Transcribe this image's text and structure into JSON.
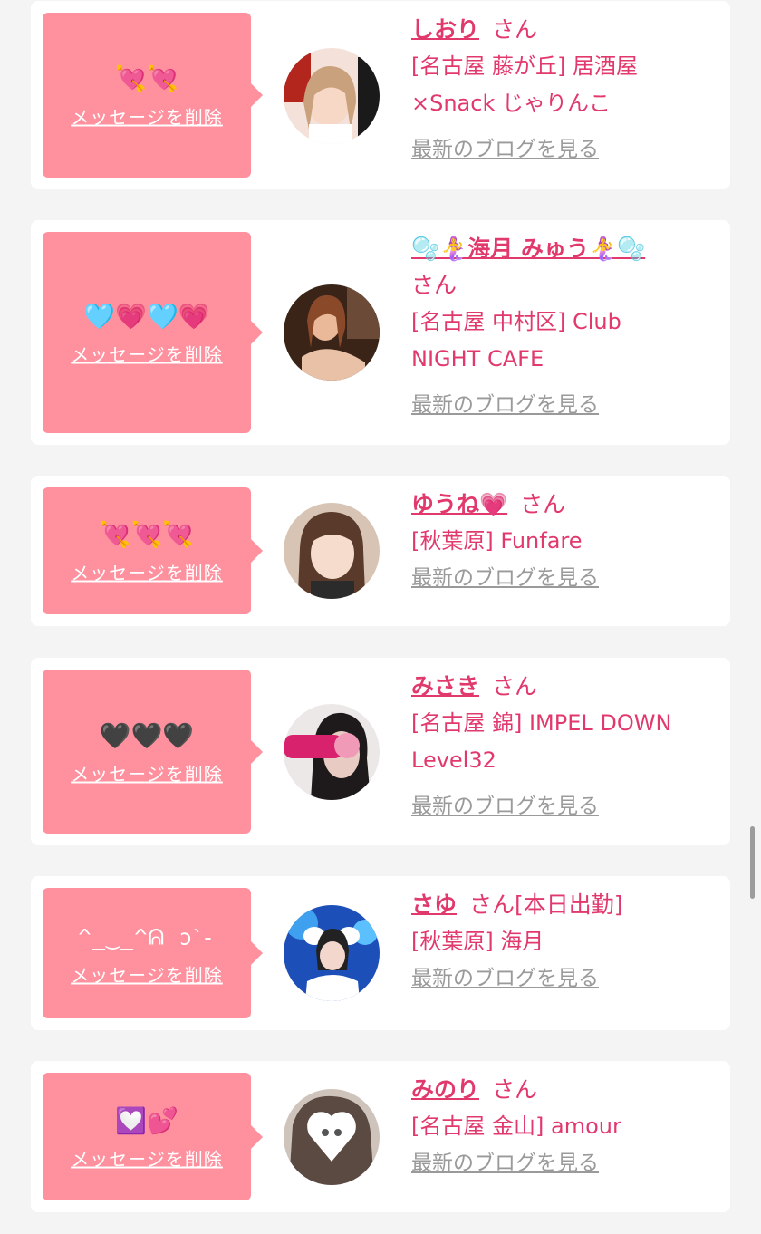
{
  "delete_label": "メッセージを削除",
  "blog_label": "最新のブログを見る",
  "honorific": "さん",
  "colors": {
    "bubble": "#ff909e",
    "accent": "#e2396d",
    "link_gray": "#9a9a9a",
    "card": "#ffffff",
    "background": "#f4f4f4"
  },
  "messages": [
    {
      "message": "💘💘",
      "name": "しおり",
      "extra": "",
      "shop_line1": "[名古屋 藤が丘] 居酒屋",
      "shop_line2": "×Snack じゃりんこ",
      "avatar_icon": "girl-photo-icon"
    },
    {
      "message": "🩵💗🩵💗",
      "name": "🫧🧜‍♀️海月 みゅう🧜‍♀️🫧",
      "extra": "",
      "shop_line1": "[名古屋 中村区] Club",
      "shop_line2": "NIGHT CAFE",
      "avatar_icon": "girl-photo-icon"
    },
    {
      "message": "💘💘💘",
      "name": "ゆうね💗",
      "extra": "",
      "shop_line1": "[秋葉原] Funfare",
      "shop_line2": "",
      "avatar_icon": "girl-photo-icon"
    },
    {
      "message": "🖤🖤🖤",
      "name": "みさき",
      "extra": "",
      "shop_line1": "[名古屋 錦] IMPEL DOWN",
      "shop_line2": "Level32",
      "avatar_icon": "girl-photo-icon"
    },
    {
      "message": "^_‿_^ᕱ ͻˋ-",
      "name": "さゆ",
      "extra": "[本日出勤]",
      "shop_line1": "[秋葉原] 海月",
      "shop_line2": "",
      "avatar_icon": "girl-photo-icon"
    },
    {
      "message": "💟💕",
      "name": "みのり",
      "extra": "",
      "shop_line1": "[名古屋 金山] amour",
      "shop_line2": "",
      "avatar_icon": "girl-photo-icon"
    }
  ]
}
